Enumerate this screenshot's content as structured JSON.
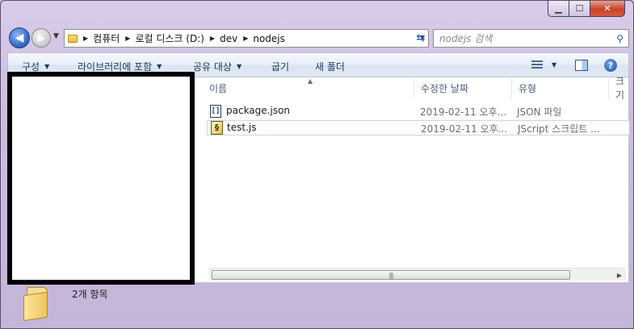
{
  "window": {
    "caption_buttons": {
      "minimize": "▁",
      "maximize": "☐",
      "close": "✕"
    }
  },
  "nav": {
    "back_icon": "back-arrow-icon",
    "forward_icon": "forward-arrow-icon",
    "breadcrumbs": [
      "컴퓨터",
      "로컬 디스크 (D:)",
      "dev",
      "nodejs"
    ],
    "search_placeholder": "nodejs 검색"
  },
  "toolbar": {
    "organize": "구성",
    "include_in_library": "라이브러리에 포함",
    "share_with": "공유 대상",
    "burn": "굽기",
    "new_folder": "새 폴더"
  },
  "columns": {
    "name": "이름",
    "date_modified": "수정한 날짜",
    "type": "유형",
    "size": "크기"
  },
  "files": [
    {
      "name": "package.json",
      "date": "2019-02-11 오후...",
      "type": "JSON 파일",
      "icon": "json-file-icon"
    },
    {
      "name": "test.js",
      "date": "2019-02-11 오후...",
      "type": "JScript 스크립트 ...",
      "icon": "js-file-icon"
    }
  ],
  "details": {
    "item_count": "2개 항목"
  },
  "colors": {
    "window_frame": "#c7b9dc",
    "toolbar_text": "#1e395b",
    "header_text": "#4c607a",
    "meta_text": "#6d6d6d"
  }
}
